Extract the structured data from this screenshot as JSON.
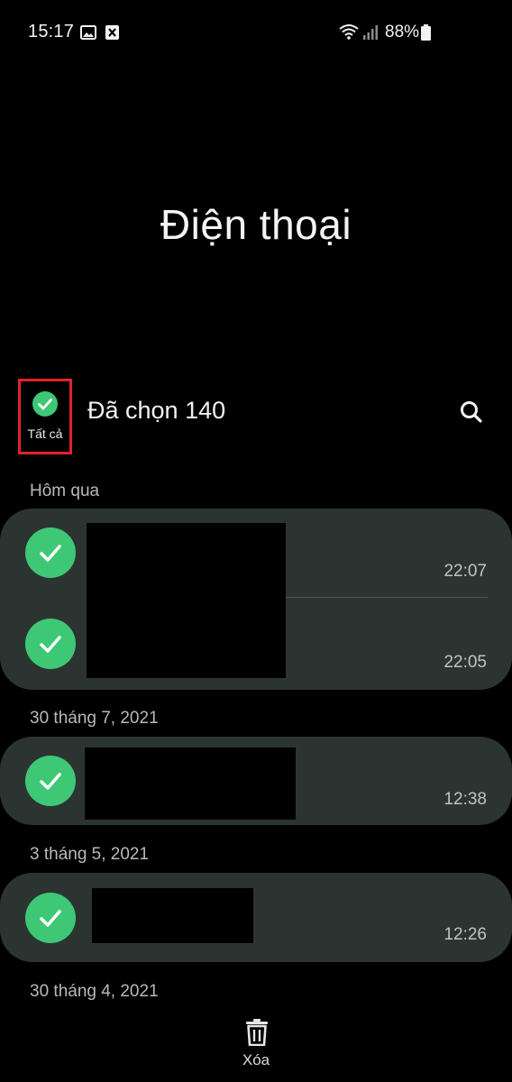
{
  "status_bar": {
    "time": "15:17",
    "battery_percent": "88%",
    "icons": [
      "image-icon",
      "blocked-notification-icon",
      "wifi-icon",
      "signal-icon",
      "battery-icon"
    ]
  },
  "header": {
    "title": "Điện thoại",
    "select_all_label": "Tất cả",
    "selected_count_label": "Đã chọn 140"
  },
  "groups": [
    {
      "date": "Hôm qua",
      "calls": [
        {
          "time": "22:07",
          "selected": true
        },
        {
          "time": "22:05",
          "selected": true
        }
      ]
    },
    {
      "date": "30 tháng 7, 2021",
      "calls": [
        {
          "time": "12:38",
          "selected": true
        }
      ]
    },
    {
      "date": "3 tháng 5, 2021",
      "calls": [
        {
          "time": "12:26",
          "selected": true
        }
      ]
    },
    {
      "date": "30 tháng 4, 2021",
      "calls": []
    }
  ],
  "bottom_bar": {
    "delete_label": "Xóa"
  },
  "colors": {
    "accent_green": "#3ec876",
    "card_background": "#2c3431",
    "highlight_border": "#e0232a"
  }
}
